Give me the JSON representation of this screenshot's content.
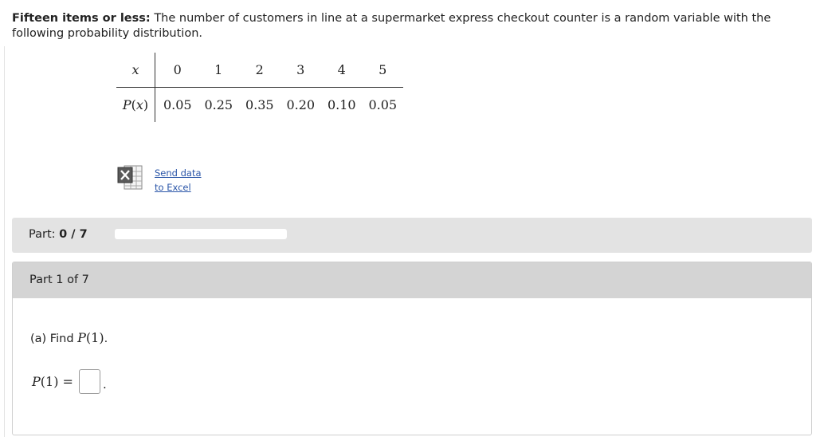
{
  "problem": {
    "title": "Fifteen items or less:",
    "text": "The number of customers in line at a supermarket express checkout counter is a random variable with the following probability distribution."
  },
  "table": {
    "x_label": "x",
    "px_p": "P",
    "px_x": "x",
    "x_values": [
      "0",
      "1",
      "2",
      "3",
      "4",
      "5"
    ],
    "p_values": [
      "0.05",
      "0.25",
      "0.35",
      "0.20",
      "0.10",
      "0.05"
    ]
  },
  "excel": {
    "line1": "Send data",
    "line2": "to Excel",
    "icon": "excel-icon"
  },
  "progress": {
    "label": "Part:",
    "count": "0 / 7",
    "completed": 0,
    "total": 7
  },
  "part": {
    "title": "Part 1 of 7",
    "question_prefix": "(a) Find",
    "p_symbol": "P",
    "arg": "1",
    "answer_value": ""
  },
  "colors": {
    "bar_background": "#e3e3e3",
    "panel_header": "#d4d4d4",
    "link": "#2a55a8"
  }
}
